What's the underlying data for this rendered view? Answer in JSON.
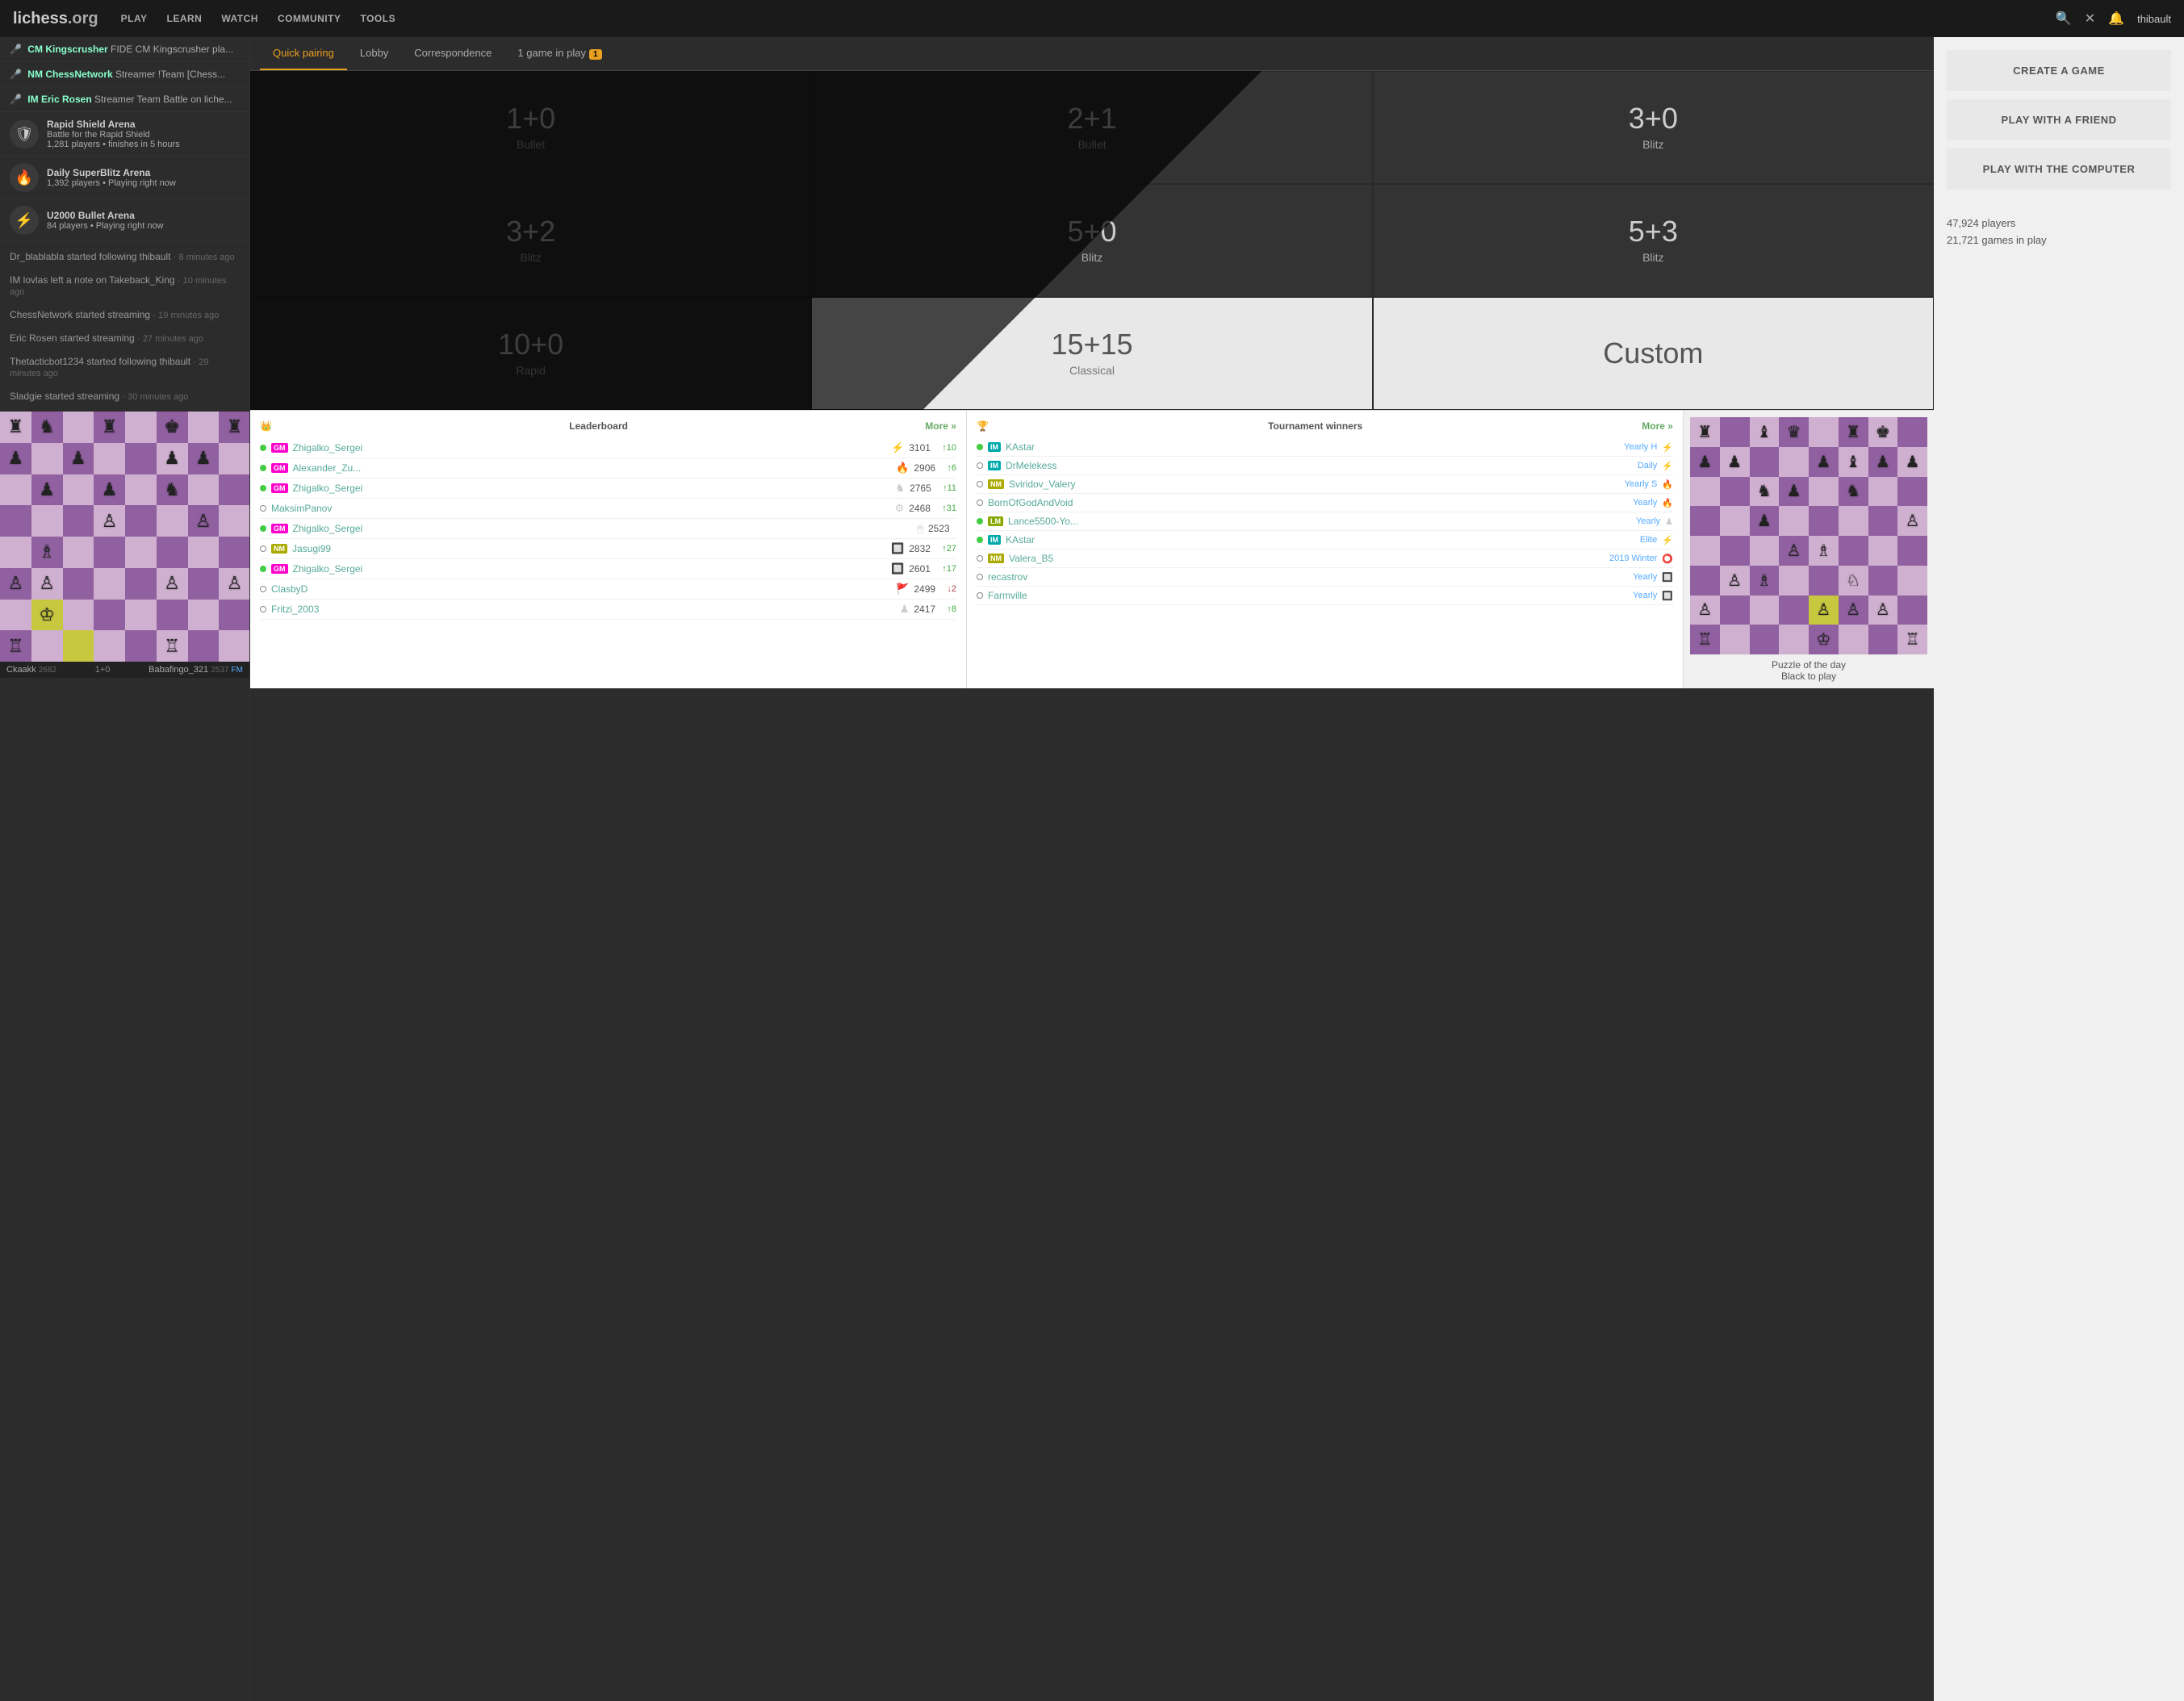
{
  "logo": {
    "text": "lichess",
    "domain": ".org"
  },
  "nav": {
    "links": [
      "PLAY",
      "LEARN",
      "WATCH",
      "COMMUNITY",
      "TOOLS"
    ],
    "username": "thibault"
  },
  "tabs": [
    {
      "label": "Quick pairing",
      "active": true
    },
    {
      "label": "Lobby",
      "active": false
    },
    {
      "label": "Correspondence",
      "active": false
    },
    {
      "label": "1 game in play",
      "badge": "1",
      "active": false
    }
  ],
  "quick_pairing": {
    "cells": [
      {
        "time": "1+0",
        "type": "Bullet",
        "dark": true
      },
      {
        "time": "2+1",
        "type": "Bullet",
        "dark": true
      },
      {
        "time": "3+0",
        "type": "Blitz",
        "dark": true
      },
      {
        "time": "3+2",
        "type": "Blitz",
        "dark": true
      },
      {
        "time": "5+0",
        "type": "Blitz",
        "dark": true
      },
      {
        "time": "5+3",
        "type": "Blitz",
        "dark": true
      },
      {
        "time": "10+0",
        "type": "Rapid",
        "dark": true
      },
      {
        "time": "15+15",
        "type": "Classical",
        "dark": false
      },
      {
        "time": "Custom",
        "type": "",
        "dark": false
      }
    ]
  },
  "right_panel": {
    "buttons": [
      {
        "label": "CREATE A GAME"
      },
      {
        "label": "PLAY WITH A FRIEND"
      },
      {
        "label": "PLAY WITH THE COMPUTER"
      }
    ],
    "stats": {
      "players": "47,924 players",
      "games": "21,721 games in play"
    }
  },
  "streamers": [
    {
      "title": "CM",
      "name": "Kingscrusher",
      "desc": "FIDE CM Kingscrusher pla..."
    },
    {
      "title": "NM",
      "name": "ChessNetwork",
      "desc": "Streamer !Team [Chess..."
    },
    {
      "title": "IM",
      "name": "Eric Rosen",
      "desc": "Streamer Team Battle on liche..."
    }
  ],
  "tournaments": [
    {
      "icon": "🛡",
      "name": "Rapid Shield Arena",
      "sub": "Battle for the Rapid Shield",
      "players": "1,281 players",
      "time": "finishes in 5 hours"
    },
    {
      "icon": "🔥",
      "name": "Daily SuperBlitz Arena",
      "sub": "",
      "players": "1,392 players",
      "time": "Playing right now"
    },
    {
      "icon": "⚡",
      "name": "U2000 Bullet Arena",
      "sub": "",
      "players": "84 players",
      "time": "Playing right now"
    }
  ],
  "activity": [
    {
      "text": "Dr_blablabla started following thibault",
      "time": "8 minutes ago"
    },
    {
      "text": "IM lovlas left a note on Takeback_King",
      "time": "10 minutes ago"
    },
    {
      "text": "ChessNetwork started streaming",
      "time": "19 minutes ago"
    },
    {
      "text": "Eric Rosen started streaming",
      "time": "27 minutes ago"
    },
    {
      "text": "Thetacticbot1234 started following thibault",
      "time": "29 minutes ago"
    },
    {
      "text": "Sladgie started streaming",
      "time": "30 minutes ago"
    }
  ],
  "mini_game": {
    "player1": "Ckaakk",
    "rating1": "2682",
    "player2": "Babafingo_321",
    "rating2": "2537",
    "title2": "FM",
    "control": "1+0"
  },
  "leaderboard": {
    "title": "Leaderboard",
    "more": "More »",
    "rows": [
      {
        "online": true,
        "title": "GM",
        "name": "Zhigalko_Sergei",
        "icon": "⚡",
        "rating": "3101",
        "gain": "↑10",
        "positive": true
      },
      {
        "online": true,
        "title": "GM",
        "name": "Alexander_Zu...",
        "icon": "🔥",
        "rating": "2906",
        "gain": "↑6",
        "positive": true
      },
      {
        "online": true,
        "title": "GM",
        "name": "Zhigalko_Sergei",
        "icon": "♞",
        "rating": "2765",
        "gain": "↑11",
        "positive": true
      },
      {
        "online": false,
        "title": "",
        "name": "MaksimPanov",
        "icon": "⚙",
        "rating": "2468",
        "gain": "↑31",
        "positive": true
      },
      {
        "online": true,
        "title": "GM",
        "name": "Zhigalko_Sergei",
        "icon": "🖱",
        "rating": "2523",
        "gain": "",
        "positive": true
      },
      {
        "online": false,
        "title": "NM",
        "name": "Jasugi99",
        "icon": "🔲",
        "rating": "2832",
        "gain": "↑27",
        "positive": true
      },
      {
        "online": true,
        "title": "GM",
        "name": "Zhigalko_Sergei",
        "icon": "🔲",
        "rating": "2601",
        "gain": "↑17",
        "positive": true
      },
      {
        "online": false,
        "title": "",
        "name": "ClasbyD",
        "icon": "🚩",
        "rating": "2499",
        "gain": "↓2",
        "positive": false
      },
      {
        "online": false,
        "title": "",
        "name": "Fritzi_2003",
        "icon": "♟",
        "rating": "2417",
        "gain": "↑8",
        "positive": true
      }
    ]
  },
  "tournament_winners": {
    "title": "Tournament winners",
    "more": "More »",
    "rows": [
      {
        "online": true,
        "title": "IM",
        "name": "KAstar",
        "tournament": "Yearly H",
        "icon": "⚡"
      },
      {
        "online": false,
        "title": "IM",
        "name": "DrMelekess",
        "tournament": "Daily",
        "icon": "⚡"
      },
      {
        "online": false,
        "title": "NM",
        "name": "Sviridov_Valery",
        "tournament": "Yearly S",
        "icon": "🔥"
      },
      {
        "online": false,
        "title": "",
        "name": "BornOfGodAndVoid",
        "tournament": "Yearly",
        "icon": "🔥"
      },
      {
        "online": true,
        "title": "LM",
        "name": "Lance5500-Yo...",
        "tournament": "Yearly",
        "icon": "♟"
      },
      {
        "online": true,
        "title": "IM",
        "name": "KAstar",
        "tournament": "Elite",
        "icon": "⚡"
      },
      {
        "online": false,
        "title": "NM",
        "name": "Valera_B5",
        "tournament": "2019 Winter",
        "icon": "⭕"
      },
      {
        "online": false,
        "title": "",
        "name": "recastrov",
        "tournament": "Yearly",
        "icon": "🔲"
      },
      {
        "online": false,
        "title": "",
        "name": "Farmville",
        "tournament": "Yearly",
        "icon": "🔲"
      }
    ]
  },
  "puzzle": {
    "title": "Puzzle of the day",
    "subtitle": "Black to play"
  }
}
